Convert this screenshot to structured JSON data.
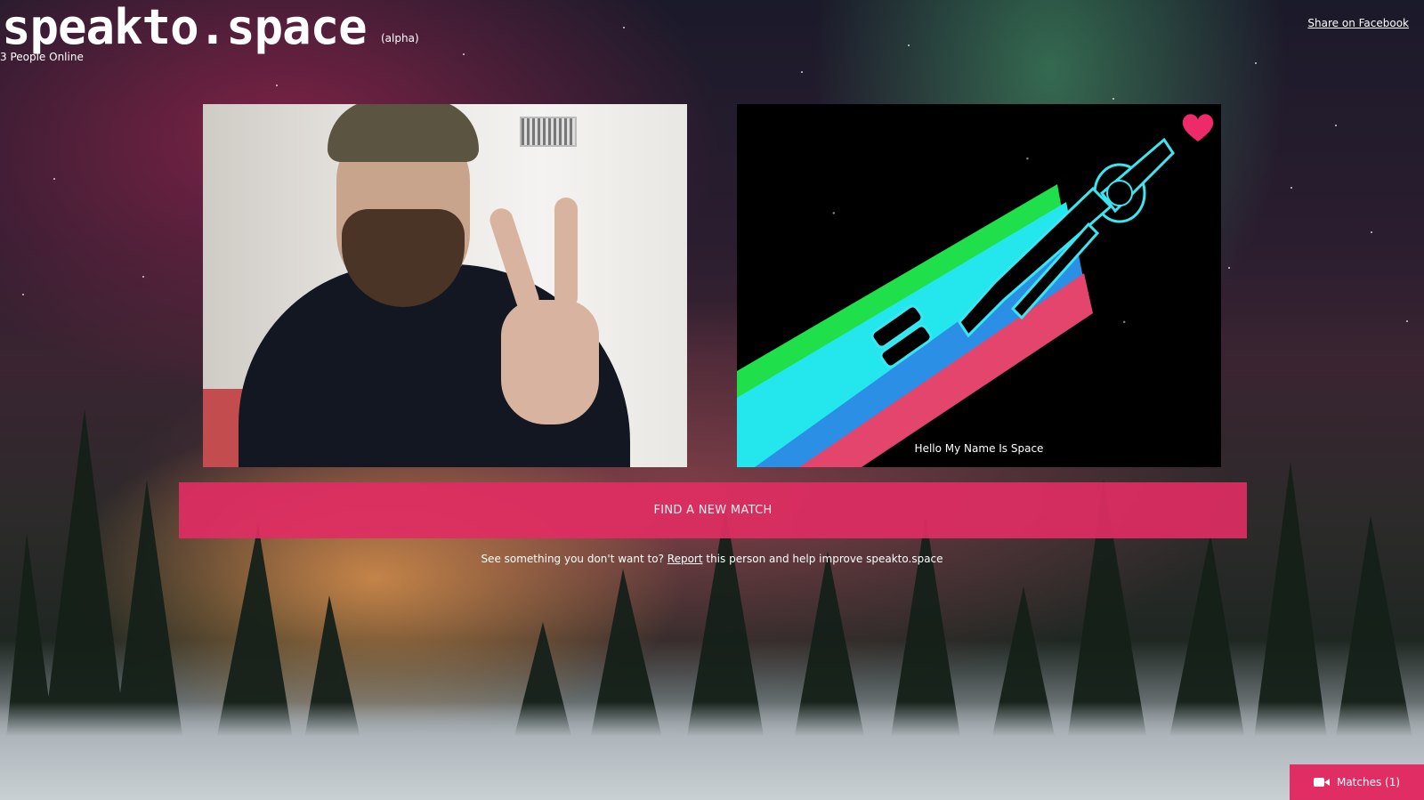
{
  "header": {
    "logo": "speakto.space",
    "badge": "(alpha)",
    "online_count": "3 People Online",
    "share_link": "Share on Facebook"
  },
  "partner": {
    "caption": "Hello My Name Is Space"
  },
  "actions": {
    "find_new_match": "FIND A NEW MATCH"
  },
  "report": {
    "prefix": "See something you don't want to?",
    "link": "Report",
    "suffix": "this person and help improve speakto.space"
  },
  "matches": {
    "label": "Matches (1)"
  },
  "icons": {
    "like": "heart-icon",
    "matches": "video-camera-icon"
  },
  "colors": {
    "accent": "#e02d63",
    "heart": "#ee2a6b"
  }
}
